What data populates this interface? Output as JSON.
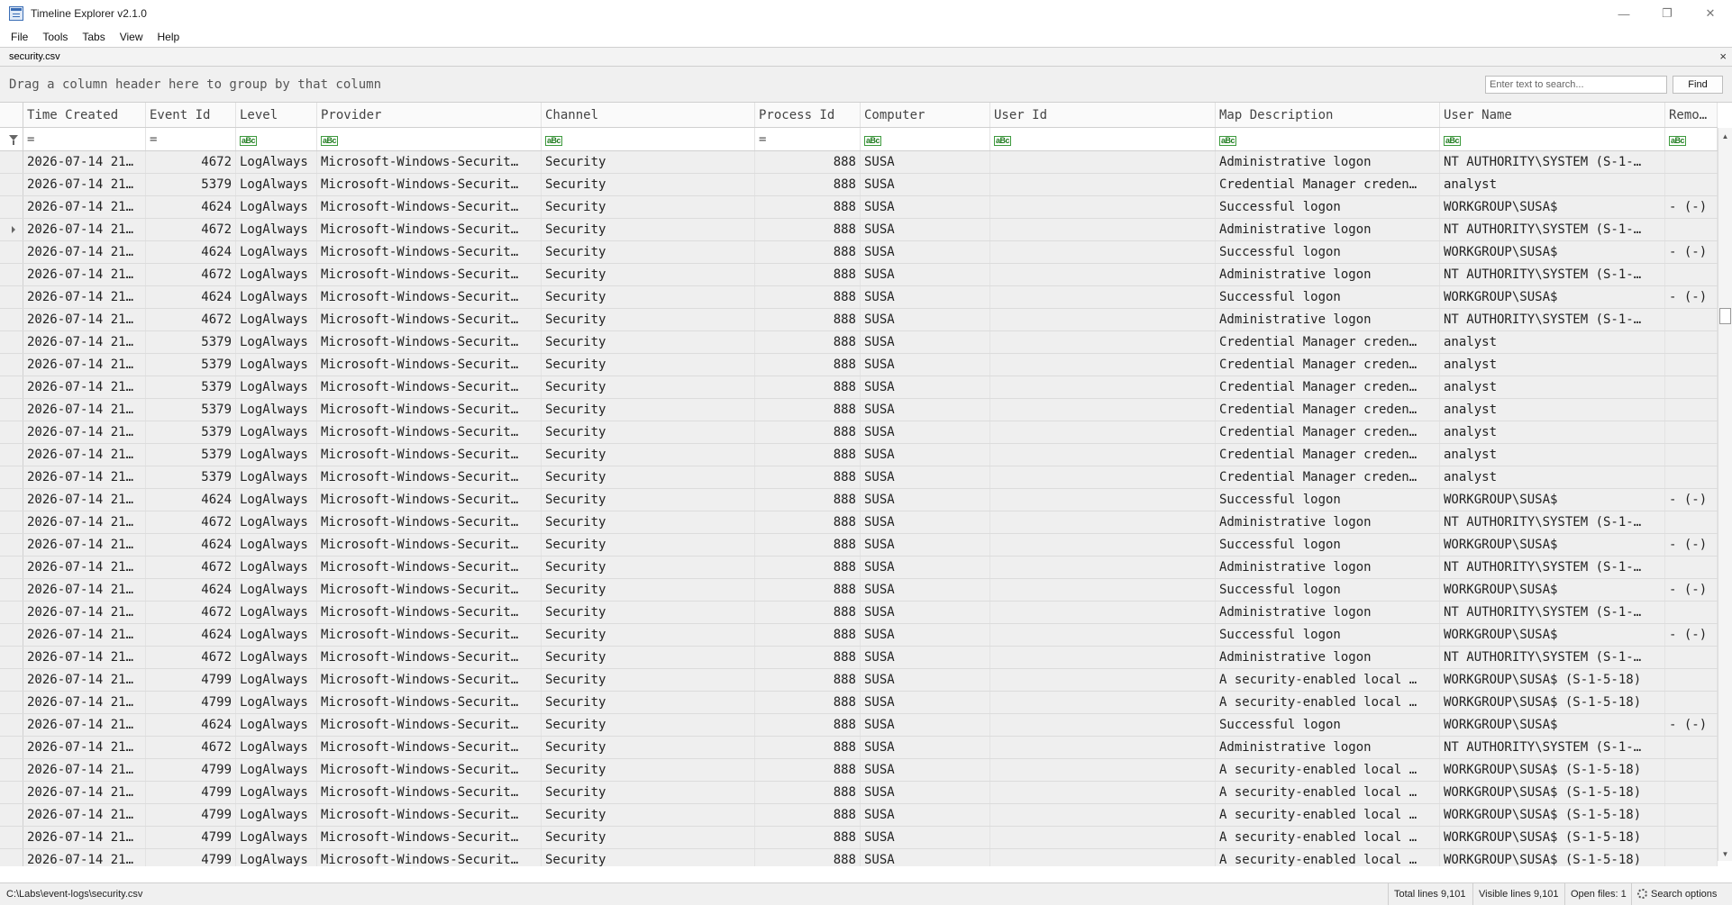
{
  "window": {
    "title": "Timeline Explorer v2.1.0"
  },
  "menu": [
    "File",
    "Tools",
    "Tabs",
    "View",
    "Help"
  ],
  "tab": {
    "file_label": "security.csv",
    "close_glyph": "×"
  },
  "group_bar": {
    "hint": "Drag a column header here to group by that column",
    "search_placeholder": "Enter text to search...",
    "find_label": "Find"
  },
  "columns": [
    {
      "label": "Time Created",
      "filter": "="
    },
    {
      "label": "Event Id",
      "filter": "="
    },
    {
      "label": "Level",
      "filter": "ABC"
    },
    {
      "label": "Provider",
      "filter": "ABC"
    },
    {
      "label": "Channel",
      "filter": "ABC"
    },
    {
      "label": "Process Id",
      "filter": "="
    },
    {
      "label": "Computer",
      "filter": "ABC"
    },
    {
      "label": "User Id",
      "filter": "ABC"
    },
    {
      "label": "Map Description",
      "filter": "ABC"
    },
    {
      "label": "User Name",
      "filter": "ABC"
    },
    {
      "label": "Remote I",
      "filter": "ABC"
    }
  ],
  "rows": [
    [
      "2026-07-14 21…",
      "4672",
      "LogAlways",
      "Microsoft-Windows-Securit…",
      "Security",
      "888",
      "SUSA",
      "",
      "Administrative logon",
      "NT AUTHORITY\\SYSTEM (S-1-…",
      ""
    ],
    [
      "2026-07-14 21…",
      "5379",
      "LogAlways",
      "Microsoft-Windows-Securit…",
      "Security",
      "888",
      "SUSA",
      "",
      "Credential Manager creden…",
      "analyst",
      ""
    ],
    [
      "2026-07-14 21…",
      "4624",
      "LogAlways",
      "Microsoft-Windows-Securit…",
      "Security",
      "888",
      "SUSA",
      "",
      "Successful logon",
      "WORKGROUP\\SUSA$",
      "- (-)"
    ],
    [
      "2026-07-14 21…",
      "4672",
      "LogAlways",
      "Microsoft-Windows-Securit…",
      "Security",
      "888",
      "SUSA",
      "",
      "Administrative logon",
      "NT AUTHORITY\\SYSTEM (S-1-…",
      ""
    ],
    [
      "2026-07-14 21…",
      "4624",
      "LogAlways",
      "Microsoft-Windows-Securit…",
      "Security",
      "888",
      "SUSA",
      "",
      "Successful logon",
      "WORKGROUP\\SUSA$",
      "- (-)"
    ],
    [
      "2026-07-14 21…",
      "4672",
      "LogAlways",
      "Microsoft-Windows-Securit…",
      "Security",
      "888",
      "SUSA",
      "",
      "Administrative logon",
      "NT AUTHORITY\\SYSTEM (S-1-…",
      ""
    ],
    [
      "2026-07-14 21…",
      "4624",
      "LogAlways",
      "Microsoft-Windows-Securit…",
      "Security",
      "888",
      "SUSA",
      "",
      "Successful logon",
      "WORKGROUP\\SUSA$",
      "- (-)"
    ],
    [
      "2026-07-14 21…",
      "4672",
      "LogAlways",
      "Microsoft-Windows-Securit…",
      "Security",
      "888",
      "SUSA",
      "",
      "Administrative logon",
      "NT AUTHORITY\\SYSTEM (S-1-…",
      ""
    ],
    [
      "2026-07-14 21…",
      "5379",
      "LogAlways",
      "Microsoft-Windows-Securit…",
      "Security",
      "888",
      "SUSA",
      "",
      "Credential Manager creden…",
      "analyst",
      ""
    ],
    [
      "2026-07-14 21…",
      "5379",
      "LogAlways",
      "Microsoft-Windows-Securit…",
      "Security",
      "888",
      "SUSA",
      "",
      "Credential Manager creden…",
      "analyst",
      ""
    ],
    [
      "2026-07-14 21…",
      "5379",
      "LogAlways",
      "Microsoft-Windows-Securit…",
      "Security",
      "888",
      "SUSA",
      "",
      "Credential Manager creden…",
      "analyst",
      ""
    ],
    [
      "2026-07-14 21…",
      "5379",
      "LogAlways",
      "Microsoft-Windows-Securit…",
      "Security",
      "888",
      "SUSA",
      "",
      "Credential Manager creden…",
      "analyst",
      ""
    ],
    [
      "2026-07-14 21…",
      "5379",
      "LogAlways",
      "Microsoft-Windows-Securit…",
      "Security",
      "888",
      "SUSA",
      "",
      "Credential Manager creden…",
      "analyst",
      ""
    ],
    [
      "2026-07-14 21…",
      "5379",
      "LogAlways",
      "Microsoft-Windows-Securit…",
      "Security",
      "888",
      "SUSA",
      "",
      "Credential Manager creden…",
      "analyst",
      ""
    ],
    [
      "2026-07-14 21…",
      "5379",
      "LogAlways",
      "Microsoft-Windows-Securit…",
      "Security",
      "888",
      "SUSA",
      "",
      "Credential Manager creden…",
      "analyst",
      ""
    ],
    [
      "2026-07-14 21…",
      "4624",
      "LogAlways",
      "Microsoft-Windows-Securit…",
      "Security",
      "888",
      "SUSA",
      "",
      "Successful logon",
      "WORKGROUP\\SUSA$",
      "- (-)"
    ],
    [
      "2026-07-14 21…",
      "4672",
      "LogAlways",
      "Microsoft-Windows-Securit…",
      "Security",
      "888",
      "SUSA",
      "",
      "Administrative logon",
      "NT AUTHORITY\\SYSTEM (S-1-…",
      ""
    ],
    [
      "2026-07-14 21…",
      "4624",
      "LogAlways",
      "Microsoft-Windows-Securit…",
      "Security",
      "888",
      "SUSA",
      "",
      "Successful logon",
      "WORKGROUP\\SUSA$",
      "- (-)"
    ],
    [
      "2026-07-14 21…",
      "4672",
      "LogAlways",
      "Microsoft-Windows-Securit…",
      "Security",
      "888",
      "SUSA",
      "",
      "Administrative logon",
      "NT AUTHORITY\\SYSTEM (S-1-…",
      ""
    ],
    [
      "2026-07-14 21…",
      "4624",
      "LogAlways",
      "Microsoft-Windows-Securit…",
      "Security",
      "888",
      "SUSA",
      "",
      "Successful logon",
      "WORKGROUP\\SUSA$",
      "- (-)"
    ],
    [
      "2026-07-14 21…",
      "4672",
      "LogAlways",
      "Microsoft-Windows-Securit…",
      "Security",
      "888",
      "SUSA",
      "",
      "Administrative logon",
      "NT AUTHORITY\\SYSTEM (S-1-…",
      ""
    ],
    [
      "2026-07-14 21…",
      "4624",
      "LogAlways",
      "Microsoft-Windows-Securit…",
      "Security",
      "888",
      "SUSA",
      "",
      "Successful logon",
      "WORKGROUP\\SUSA$",
      "- (-)"
    ],
    [
      "2026-07-14 21…",
      "4672",
      "LogAlways",
      "Microsoft-Windows-Securit…",
      "Security",
      "888",
      "SUSA",
      "",
      "Administrative logon",
      "NT AUTHORITY\\SYSTEM (S-1-…",
      ""
    ],
    [
      "2026-07-14 21…",
      "4799",
      "LogAlways",
      "Microsoft-Windows-Securit…",
      "Security",
      "888",
      "SUSA",
      "",
      "A security-enabled local …",
      "WORKGROUP\\SUSA$ (S-1-5-18)",
      ""
    ],
    [
      "2026-07-14 21…",
      "4799",
      "LogAlways",
      "Microsoft-Windows-Securit…",
      "Security",
      "888",
      "SUSA",
      "",
      "A security-enabled local …",
      "WORKGROUP\\SUSA$ (S-1-5-18)",
      ""
    ],
    [
      "2026-07-14 21…",
      "4624",
      "LogAlways",
      "Microsoft-Windows-Securit…",
      "Security",
      "888",
      "SUSA",
      "",
      "Successful logon",
      "WORKGROUP\\SUSA$",
      "- (-)"
    ],
    [
      "2026-07-14 21…",
      "4672",
      "LogAlways",
      "Microsoft-Windows-Securit…",
      "Security",
      "888",
      "SUSA",
      "",
      "Administrative logon",
      "NT AUTHORITY\\SYSTEM (S-1-…",
      ""
    ],
    [
      "2026-07-14 21…",
      "4799",
      "LogAlways",
      "Microsoft-Windows-Securit…",
      "Security",
      "888",
      "SUSA",
      "",
      "A security-enabled local …",
      "WORKGROUP\\SUSA$ (S-1-5-18)",
      ""
    ],
    [
      "2026-07-14 21…",
      "4799",
      "LogAlways",
      "Microsoft-Windows-Securit…",
      "Security",
      "888",
      "SUSA",
      "",
      "A security-enabled local …",
      "WORKGROUP\\SUSA$ (S-1-5-18)",
      ""
    ],
    [
      "2026-07-14 21…",
      "4799",
      "LogAlways",
      "Microsoft-Windows-Securit…",
      "Security",
      "888",
      "SUSA",
      "",
      "A security-enabled local …",
      "WORKGROUP\\SUSA$ (S-1-5-18)",
      ""
    ],
    [
      "2026-07-14 21…",
      "4799",
      "LogAlways",
      "Microsoft-Windows-Securit…",
      "Security",
      "888",
      "SUSA",
      "",
      "A security-enabled local …",
      "WORKGROUP\\SUSA$ (S-1-5-18)",
      ""
    ],
    [
      "2026-07-14 21…",
      "4799",
      "LogAlways",
      "Microsoft-Windows-Securit…",
      "Security",
      "888",
      "SUSA",
      "",
      "A security-enabled local …",
      "WORKGROUP\\SUSA$ (S-1-5-18)",
      ""
    ]
  ],
  "current_row": 3,
  "status": {
    "path": "C:\\Labs\\event-logs\\security.csv",
    "total_lines": "Total lines 9,101",
    "visible_lines": "Visible lines 9,101",
    "open_files": "Open files: 1",
    "search_options": "Search options"
  },
  "colors": {
    "row_bg": "#efefef",
    "header_bg": "#fafafa",
    "filter_icon": "#1d7a1d"
  }
}
